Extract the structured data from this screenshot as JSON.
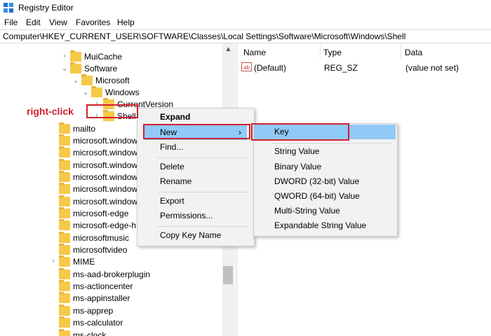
{
  "window": {
    "title": "Registry Editor"
  },
  "menubar": [
    "File",
    "Edit",
    "View",
    "Favorites",
    "Help"
  ],
  "address": "Computer\\HKEY_CURRENT_USER\\SOFTWARE\\Classes\\Local Settings\\Software\\Microsoft\\Windows\\Shell",
  "tree": {
    "items": [
      {
        "label": "MuiCache",
        "expander": "›"
      },
      {
        "label": "Software",
        "expander": "⌄"
      },
      {
        "label": "Microsoft",
        "expander": "⌄"
      },
      {
        "label": "Windows",
        "expander": "⌄"
      },
      {
        "label": "CurrentVersion",
        "expander": "›"
      },
      {
        "label": "Shell",
        "expander": "›"
      },
      {
        "label": "mailto",
        "expander": ""
      },
      {
        "label": "microsoft.window",
        "expander": ""
      },
      {
        "label": "microsoft.window",
        "expander": ""
      },
      {
        "label": "microsoft.window",
        "expander": ""
      },
      {
        "label": "microsoft.window",
        "expander": ""
      },
      {
        "label": "microsoft.window",
        "expander": ""
      },
      {
        "label": "microsoft.window",
        "expander": ""
      },
      {
        "label": "microsoft-edge",
        "expander": ""
      },
      {
        "label": "microsoft-edge-h",
        "expander": ""
      },
      {
        "label": "microsoftmusic",
        "expander": ""
      },
      {
        "label": "microsoftvideo",
        "expander": ""
      },
      {
        "label": "MIME",
        "expander": "›"
      },
      {
        "label": "ms-aad-brokerplugin",
        "expander": ""
      },
      {
        "label": "ms-actioncenter",
        "expander": ""
      },
      {
        "label": "ms-appinstaller",
        "expander": ""
      },
      {
        "label": "ms-apprep",
        "expander": ""
      },
      {
        "label": "ms-calculator",
        "expander": ""
      },
      {
        "label": "ms-clock",
        "expander": ""
      }
    ]
  },
  "list": {
    "columns": [
      "Name",
      "Type",
      "Data"
    ],
    "rows": [
      {
        "name": "(Default)",
        "type": "REG_SZ",
        "data": "(value not set)",
        "icon": "ab"
      }
    ]
  },
  "context_menu": {
    "items": [
      "Expand",
      "New",
      "Find...",
      "Delete",
      "Rename",
      "Export",
      "Permissions...",
      "Copy Key Name"
    ],
    "submenu_arrow": "›"
  },
  "submenu": {
    "items": [
      "Key",
      "String Value",
      "Binary Value",
      "DWORD (32-bit) Value",
      "QWORD (64-bit) Value",
      "Multi-String Value",
      "Expandable String Value"
    ]
  },
  "annotation": "right-click",
  "colors": {
    "highlight": "#91c9f7",
    "annotation": "#d0202f",
    "folder": "#f7c948"
  }
}
